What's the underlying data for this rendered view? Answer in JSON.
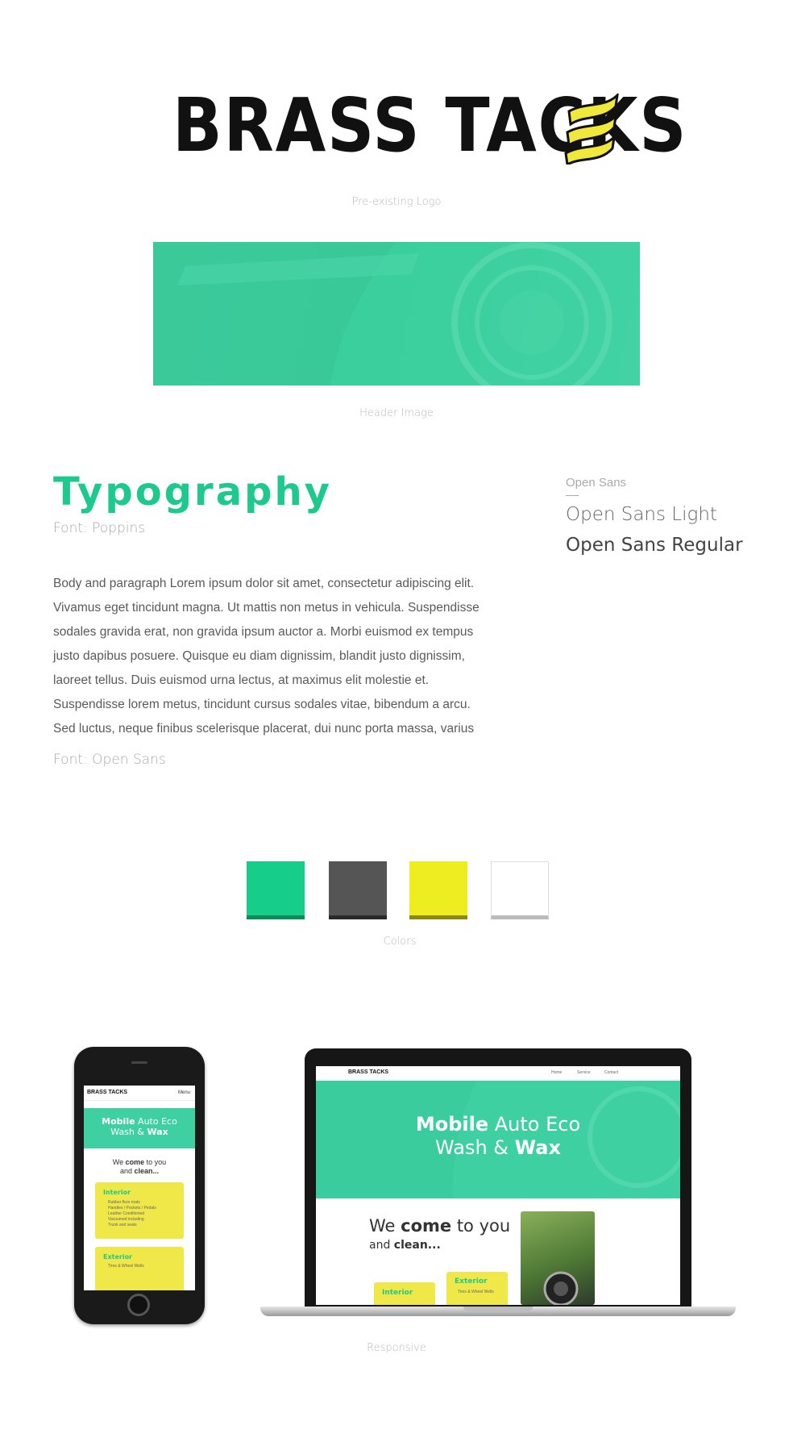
{
  "logo": {
    "text": "BRASS TACKS",
    "caption": "Pre-existing Logo",
    "accent_color": "#f0e83a"
  },
  "header_image": {
    "caption": "Header Image",
    "color": "#3fcfa0"
  },
  "typography": {
    "title": "Typography",
    "title_font_label": "Font: Poppins",
    "body_lines": [
      "Body and paragraph Lorem ipsum dolor sit amet, consectetur adipiscing elit.",
      "Vivamus eget tincidunt magna. Ut mattis non metus in vehicula. Suspendisse",
      "sodales gravida erat, non gravida ipsum auctor a. Morbi euismod ex tempus",
      "justo dapibus posuere. Quisque eu diam dignissim, blandit justo dignissim,",
      "laoreet tellus. Duis euismod urna lectus, at maximus elit molestie et.",
      "Suspendisse lorem metus, tincidunt cursus sodales vitae, bibendum a arcu.",
      "Sed luctus, neque finibus scelerisque placerat, dui nunc porta massa, varius"
    ],
    "body_font_label": "Font: Open Sans",
    "open_sans_heading": "Open Sans",
    "open_sans_light": "Open Sans Light",
    "open_sans_regular": "Open Sans Regular"
  },
  "colors": {
    "caption": "Colors",
    "swatches": [
      {
        "fill": "#17cd8a",
        "edge": "#0f8a5d"
      },
      {
        "fill": "#555555",
        "edge": "#2a2a2a"
      },
      {
        "fill": "#eded22",
        "edge": "#8a8a12"
      },
      {
        "fill": "#ffffff",
        "edge": "#bbbbbb"
      }
    ]
  },
  "responsive": {
    "caption": "Responsive",
    "phone": {
      "logo": "BRASS TACKS",
      "menu": "Menu",
      "hero_line1_bold": "Mobile",
      "hero_line1_rest": " Auto Eco",
      "hero_line2_rest": "Wash & ",
      "hero_line2_bold": "Wax",
      "come_pre": "We ",
      "come_bold": "come",
      "come_post": " to you",
      "clean_pre": "and ",
      "clean_bold": "clean...",
      "card1_title": "Interior",
      "card1_items": [
        "Rubber floor mats",
        "Handles / Pockets / Pedals",
        "Leather Conditioned",
        "Vacuumed including",
        "Trunk and seats"
      ],
      "card2_title": "Exterior",
      "card2_item": "Tires & Wheel Wells"
    },
    "laptop": {
      "logo": "BRASS TACKS",
      "nav": [
        "Home",
        "Service",
        "Contact"
      ],
      "hero_line1_bold": "Mobile",
      "hero_line1_rest": " Auto Eco",
      "hero_line2_rest": "Wash & ",
      "hero_line2_bold": "Wax",
      "come_pre": "We ",
      "come_bold": "come",
      "come_post": " to you",
      "clean_pre": "and ",
      "clean_bold": "clean...",
      "card1_title": "Interior",
      "card2_title": "Exterior",
      "card2_item": "Tires & Wheel Wells"
    }
  }
}
